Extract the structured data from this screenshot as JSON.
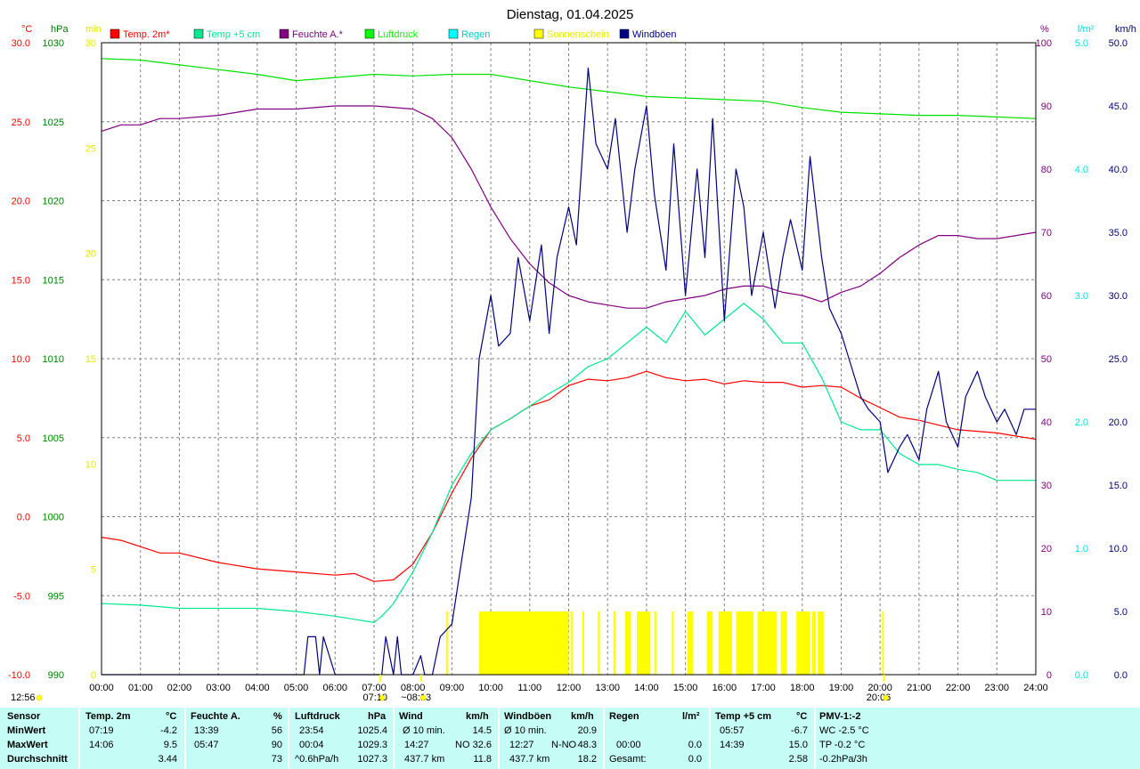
{
  "chart_data": {
    "type": "line",
    "title": "Dienstag, 01.04.2025",
    "legend": [
      {
        "label": "Temp. 2m*",
        "color": "#ff0000"
      },
      {
        "label": "Temp +5 cm",
        "color": "#00e890"
      },
      {
        "label": "Feuchte A.*",
        "color": "#800080"
      },
      {
        "label": "Luftdruck",
        "color": "#00ff00"
      },
      {
        "label": "Regen",
        "color": "#00ffff"
      },
      {
        "label": "Sonnenschein",
        "color": "#ffff00"
      },
      {
        "label": "Windböen",
        "color": "#000080"
      }
    ],
    "axes": {
      "temp": {
        "unit": "°C",
        "range": [
          -10,
          30
        ],
        "ticks": [
          "-10.0",
          "-5.0",
          "0.0",
          "5.0",
          "10.0",
          "15.0",
          "20.0",
          "25.0",
          "30.0"
        ],
        "color": "#ff0000"
      },
      "pressure": {
        "unit": "hPa",
        "range": [
          990,
          1030
        ],
        "ticks": [
          "990",
          "995",
          "1000",
          "1005",
          "1010",
          "1015",
          "1020",
          "1025",
          "1030"
        ],
        "color": "#008000"
      },
      "sun_minutes": {
        "unit": "min",
        "range": [
          0,
          30
        ],
        "ticks": [
          "0",
          "5",
          "10",
          "15",
          "20",
          "25",
          "30"
        ],
        "color": "#ffff00"
      },
      "humidity": {
        "unit": "%",
        "range": [
          0,
          100
        ],
        "ticks": [
          "0",
          "10",
          "20",
          "30",
          "40",
          "50",
          "60",
          "70",
          "80",
          "90",
          "100"
        ],
        "color": "#800080"
      },
      "rain": {
        "unit": "l/m²",
        "range": [
          0,
          5
        ],
        "ticks": [
          "0.0",
          "1.0",
          "2.0",
          "3.0",
          "4.0",
          "5.0"
        ],
        "color": "#00ffff"
      },
      "wind": {
        "unit": "km/h",
        "range": [
          0,
          50
        ],
        "ticks": [
          "0.0",
          "5.0",
          "10.0",
          "15.0",
          "20.0",
          "25.0",
          "30.0",
          "35.0",
          "40.0",
          "45.0",
          "50.0"
        ],
        "color": "#000080"
      }
    },
    "x_ticks": [
      "00:00",
      "01:00",
      "02:00",
      "03:00",
      "04:00",
      "05:00",
      "06:00",
      "07:00",
      "08:00",
      "09:00",
      "10:00",
      "11:00",
      "12:00",
      "13:00",
      "14:00",
      "15:00",
      "16:00",
      "17:00",
      "18:00",
      "19:00",
      "20:00",
      "21:00",
      "22:00",
      "23:00",
      "24:00"
    ],
    "x_markers": [
      {
        "time": "07:10",
        "label": "07:10"
      },
      {
        "time": "08:13",
        "label": "~08:13"
      },
      {
        "time": "12:56",
        "label": "12:56"
      },
      {
        "time": "20:06",
        "label": "20:06"
      }
    ],
    "grid": true,
    "series": [
      {
        "name": "Temp. 2m*",
        "axis": "temp",
        "x": [
          0,
          0.5,
          1,
          1.5,
          2,
          3,
          4,
          5,
          6,
          6.5,
          7,
          7.5,
          8,
          8.5,
          9,
          9.5,
          10,
          10.5,
          11,
          11.5,
          12,
          12.5,
          13,
          13.5,
          14,
          14.5,
          15,
          15.5,
          16,
          16.5,
          17,
          17.5,
          18,
          18.5,
          19,
          19.5,
          20,
          20.5,
          21,
          21.5,
          22,
          22.5,
          23,
          23.5,
          24
        ],
        "values": [
          -1.3,
          -1.5,
          -1.9,
          -2.3,
          -2.3,
          -2.9,
          -3.3,
          -3.5,
          -3.7,
          -3.6,
          -4.1,
          -4.0,
          -3.0,
          -1.0,
          1.5,
          3.7,
          5.5,
          6.2,
          7.0,
          7.4,
          8.3,
          8.7,
          8.6,
          8.8,
          9.2,
          8.8,
          8.6,
          8.7,
          8.4,
          8.6,
          8.5,
          8.5,
          8.2,
          8.3,
          8.2,
          7.5,
          6.9,
          6.3,
          6.1,
          5.8,
          5.5,
          5.4,
          5.3,
          5.1,
          4.9
        ]
      },
      {
        "name": "Temp +5 cm",
        "axis": "temp",
        "x": [
          0,
          1,
          2,
          3,
          4,
          5,
          6,
          7,
          7.2,
          7.5,
          8,
          8.5,
          9,
          9.5,
          10,
          10.5,
          11,
          11.5,
          12,
          12.5,
          13,
          13.5,
          14,
          14.5,
          15,
          15.5,
          16,
          16.5,
          17,
          17.5,
          18,
          18.5,
          19,
          19.5,
          20,
          20.5,
          21,
          21.5,
          22,
          22.5,
          23,
          23.5,
          24
        ],
        "values": [
          -5.5,
          -5.6,
          -5.8,
          -5.8,
          -5.8,
          -6.0,
          -6.3,
          -6.7,
          -6.3,
          -5.5,
          -3.5,
          -1.0,
          2.0,
          4.0,
          5.5,
          6.2,
          7.0,
          7.8,
          8.5,
          9.5,
          10.0,
          11.0,
          12.0,
          11.0,
          13.0,
          11.5,
          12.5,
          13.5,
          12.5,
          11.0,
          11.0,
          8.8,
          6.0,
          5.5,
          5.5,
          4.0,
          3.3,
          3.3,
          3.0,
          2.8,
          2.3,
          2.3,
          2.3
        ]
      },
      {
        "name": "Feuchte A.*",
        "axis": "humidity",
        "x": [
          0,
          0.5,
          1,
          1.5,
          2,
          3,
          4,
          5,
          6,
          7,
          8,
          8.5,
          9,
          9.5,
          10,
          10.5,
          11,
          11.5,
          12,
          12.5,
          13,
          13.5,
          14,
          14.5,
          15,
          15.5,
          16,
          16.5,
          17,
          17.5,
          18,
          18.5,
          19,
          19.5,
          20,
          20.5,
          21,
          21.5,
          22,
          22.5,
          23,
          23.5,
          24
        ],
        "values": [
          86,
          87,
          87,
          88,
          88,
          88.5,
          89.5,
          89.5,
          90,
          90,
          89.5,
          88,
          85,
          80,
          74,
          69,
          65,
          62,
          60,
          59,
          58.5,
          58,
          58,
          59,
          59.5,
          60,
          61,
          61.5,
          61.5,
          60.5,
          60,
          59,
          60.5,
          61.5,
          63.5,
          66,
          68,
          69.5,
          69.5,
          69,
          69,
          69.5,
          70
        ]
      },
      {
        "name": "Luftdruck",
        "axis": "pressure",
        "x": [
          0,
          1,
          2,
          3,
          4,
          5,
          6,
          7,
          8,
          9,
          10,
          11,
          12,
          13,
          14,
          15,
          16,
          17,
          18,
          19,
          20,
          21,
          22,
          23,
          24
        ],
        "values": [
          1029.0,
          1028.9,
          1028.6,
          1028.3,
          1028.0,
          1027.6,
          1027.8,
          1028.0,
          1027.9,
          1028.0,
          1028.0,
          1027.6,
          1027.2,
          1026.9,
          1026.6,
          1026.5,
          1026.4,
          1026.3,
          1025.9,
          1025.6,
          1025.5,
          1025.4,
          1025.4,
          1025.3,
          1025.2
        ]
      },
      {
        "name": "Windböen",
        "axis": "wind",
        "x": [
          0,
          1,
          2,
          3,
          4,
          5,
          5.2,
          5.3,
          5.5,
          5.6,
          5.7,
          6,
          7,
          7.2,
          7.3,
          7.5,
          7.6,
          7.7,
          8,
          8.2,
          8.3,
          8.5,
          8.7,
          9,
          9.2,
          9.5,
          9.7,
          10,
          10.2,
          10.5,
          10.7,
          11,
          11.3,
          11.5,
          11.7,
          12,
          12.2,
          12.5,
          12.7,
          13,
          13.2,
          13.5,
          13.7,
          14,
          14.2,
          14.5,
          14.7,
          15,
          15.3,
          15.5,
          15.7,
          16,
          16.3,
          16.5,
          16.7,
          17,
          17.3,
          17.5,
          17.7,
          18,
          18.2,
          18.5,
          18.7,
          19,
          19.2,
          19.5,
          19.7,
          20,
          20.2,
          20.5,
          20.7,
          21,
          21.2,
          21.5,
          21.7,
          22,
          22.2,
          22.5,
          22.7,
          23,
          23.2,
          23.5,
          23.7,
          24
        ],
        "values": [
          0,
          0,
          0,
          0,
          0,
          0,
          0,
          3,
          3,
          0,
          3,
          0,
          0,
          0,
          3,
          0,
          3,
          0,
          0,
          1.5,
          0,
          0,
          3,
          4,
          8,
          14,
          25,
          30,
          26,
          27,
          33,
          28,
          34,
          27,
          33,
          37,
          34,
          48,
          42,
          40,
          44,
          35,
          40,
          45,
          38,
          32,
          42,
          30,
          40,
          33,
          44,
          28,
          40,
          37,
          30,
          35,
          29,
          33,
          36,
          32,
          41,
          33,
          29,
          27,
          25,
          22,
          21,
          20,
          16,
          18,
          19,
          17,
          21,
          24,
          20,
          18,
          22,
          24,
          22,
          20,
          21,
          19,
          21,
          21
        ]
      }
    ],
    "sunshine_bars": [
      {
        "start": 8.85,
        "end": 8.88
      },
      {
        "start": 9.7,
        "end": 12.0
      },
      {
        "start": 12.05,
        "end": 12.1
      },
      {
        "start": 12.35,
        "end": 12.4
      },
      {
        "start": 12.75,
        "end": 12.8
      },
      {
        "start": 13.15,
        "end": 13.2
      },
      {
        "start": 13.45,
        "end": 13.6
      },
      {
        "start": 13.75,
        "end": 14.1
      },
      {
        "start": 14.2,
        "end": 14.25
      },
      {
        "start": 14.65,
        "end": 14.7
      },
      {
        "start": 15.05,
        "end": 15.2
      },
      {
        "start": 15.55,
        "end": 15.7
      },
      {
        "start": 15.85,
        "end": 16.2
      },
      {
        "start": 16.3,
        "end": 16.75
      },
      {
        "start": 16.85,
        "end": 17.35
      },
      {
        "start": 17.45,
        "end": 17.6
      },
      {
        "start": 17.85,
        "end": 18.2
      },
      {
        "start": 18.25,
        "end": 18.35
      },
      {
        "start": 18.4,
        "end": 18.55
      },
      {
        "start": 20.05,
        "end": 20.08
      }
    ]
  },
  "table": {
    "col_sensor": {
      "head": "Sensor",
      "r1": "MinWert",
      "r2": "MaxWert",
      "r3": "Durchschnitt"
    },
    "col_temp": {
      "head": "Temp. 2m",
      "unit": "°C",
      "r1_time": "07:19",
      "r1_val": "-4.2",
      "r2_time": "14:06",
      "r2_val": "9.5",
      "r3_val": "3.44"
    },
    "col_hum": {
      "head": "Feuchte A.",
      "unit": "%",
      "r1_time": "13:39",
      "r1_val": "56",
      "r2_time": "05:47",
      "r2_val": "90",
      "r3_val": "73"
    },
    "col_press": {
      "head": "Luftdruck",
      "unit": "hPa",
      "r1_time": "23:54",
      "r1_val": "1025.4",
      "r2_time": "00:04",
      "r2_val": "1029.3",
      "r3_label": "^0.6hPa/h",
      "r3_val": "1027.3"
    },
    "col_wind": {
      "head": "Wind",
      "unit": "km/h",
      "r1_label": "Ø 10 min.",
      "r1_val": "14.5",
      "r2_time": "14:27",
      "r2_dir": "NO",
      "r2_val": "32.6",
      "r3_label": "437.7 km",
      "r3_val": "11.8"
    },
    "col_gust": {
      "head": "Windböen",
      "unit": "km/h",
      "r1_label": "Ø 10 min.",
      "r1_val": "20.9",
      "r2_time": "12:27",
      "r2_dir": "N-NO",
      "r2_val": "48.3",
      "r3_label": "437.7 km",
      "r3_val": "18.2"
    },
    "col_rain": {
      "head": "Regen",
      "unit": "l/m²",
      "r2_time": "00:00",
      "r2_val": "0.0",
      "r3_label": "Gesamt:",
      "r3_val": "0.0"
    },
    "col_t5": {
      "head": "Temp +5 cm",
      "unit": "°C",
      "r1_time": "05:57",
      "r1_val": "-6.7",
      "r2_time": "14:39",
      "r2_val": "15.0",
      "r3_val": "2.58"
    },
    "col_pmv": {
      "head": "PMV-1:-2",
      "r1": "WC -2.5 °C",
      "r2": "TP -0.2 °C",
      "r3": "-0.2hPa/3h"
    }
  }
}
